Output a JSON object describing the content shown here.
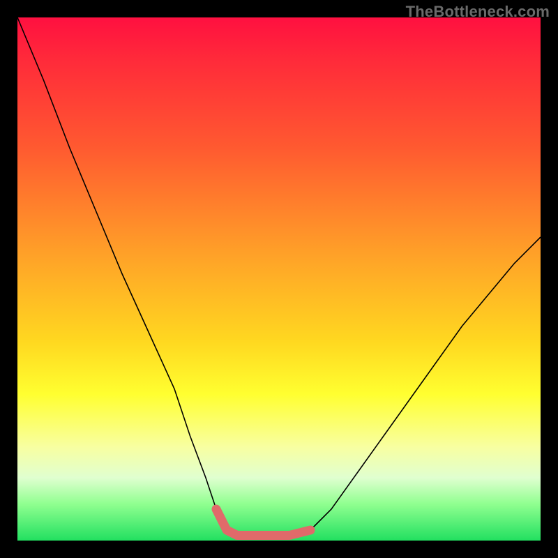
{
  "watermark": "TheBottleneck.com",
  "chart_data": {
    "type": "line",
    "title": "",
    "xlabel": "",
    "ylabel": "",
    "xlim": [
      0,
      100
    ],
    "ylim": [
      0,
      100
    ],
    "series": [
      {
        "name": "bottleneck-curve",
        "x": [
          0,
          5,
          10,
          15,
          20,
          25,
          30,
          33,
          36,
          38,
          40,
          42,
          44,
          48,
          52,
          56,
          60,
          65,
          70,
          75,
          80,
          85,
          90,
          95,
          100
        ],
        "values": [
          100,
          88,
          75,
          63,
          51,
          40,
          29,
          20,
          12,
          6,
          2,
          1,
          1,
          1,
          1,
          2,
          6,
          13,
          20,
          27,
          34,
          41,
          47,
          53,
          58
        ]
      },
      {
        "name": "highlight-segment",
        "x": [
          38,
          40,
          42,
          44,
          48,
          52,
          56
        ],
        "values": [
          6,
          2,
          1,
          1,
          1,
          1,
          2
        ]
      }
    ],
    "colors": {
      "curve": "#000000",
      "highlight": "#e06a6a"
    }
  }
}
